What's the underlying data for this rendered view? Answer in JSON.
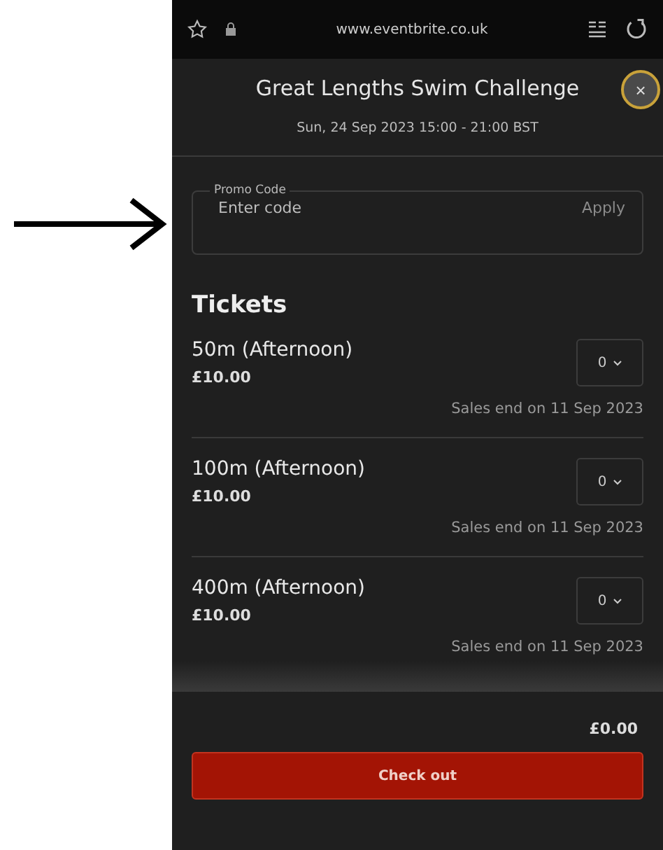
{
  "browser_bar": {
    "url": "www.eventbrite.co.uk"
  },
  "header": {
    "title": "Great Lengths Swim Challenge",
    "date": "Sun, 24 Sep 2023 15:00 - 21:00 BST",
    "close": "×"
  },
  "promo": {
    "label": "Promo Code",
    "placeholder": "Enter code",
    "apply": "Apply"
  },
  "tickets": {
    "heading": "Tickets",
    "items": [
      {
        "name": "50m (Afternoon)",
        "price": "£10.00",
        "quantity": "0",
        "sales_end": "Sales end on 11 Sep 2023"
      },
      {
        "name": "100m (Afternoon)",
        "price": "£10.00",
        "quantity": "0",
        "sales_end": "Sales end on 11 Sep 2023"
      },
      {
        "name": "400m (Afternoon)",
        "price": "£10.00",
        "quantity": "0",
        "sales_end": "Sales end on 11 Sep 2023"
      }
    ]
  },
  "footer": {
    "total": "£0.00",
    "checkout": "Check out"
  }
}
